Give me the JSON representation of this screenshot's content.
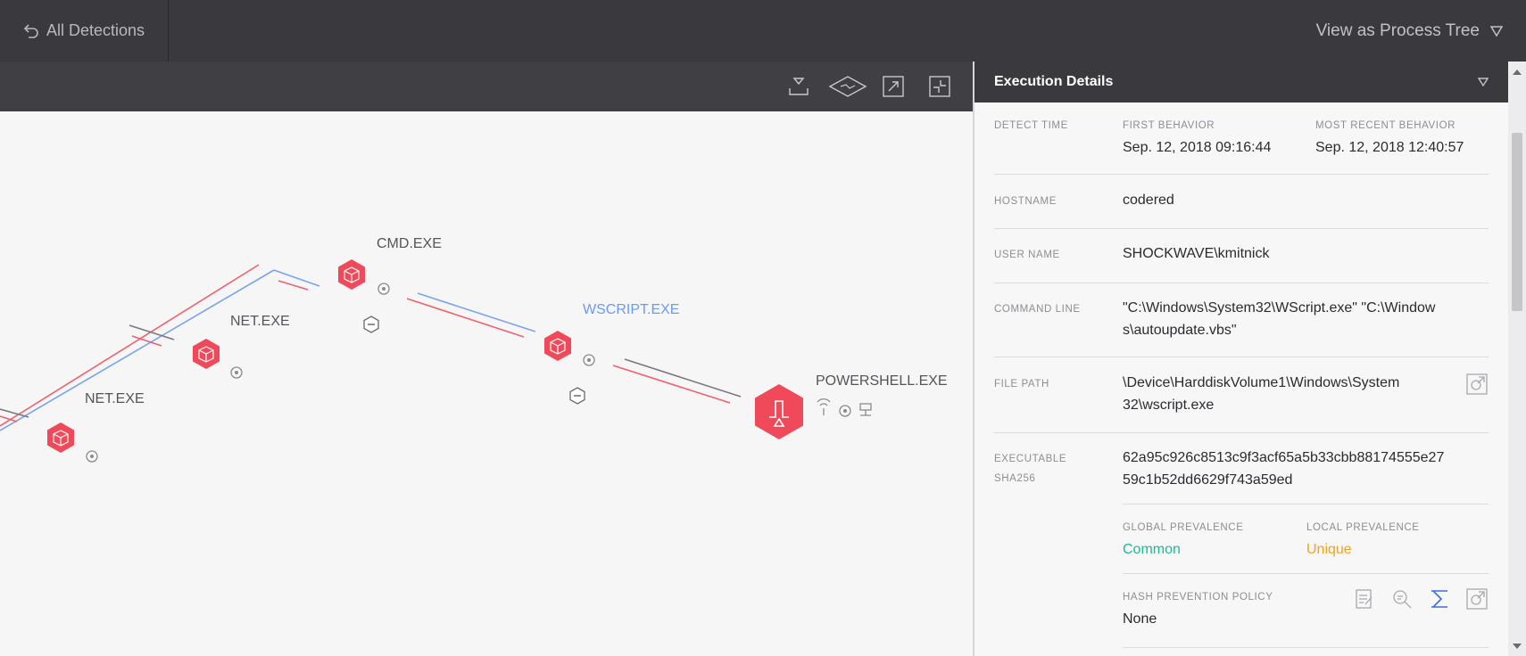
{
  "header": {
    "back_label": "All Detections",
    "view_label": "View as Process Tree"
  },
  "graph": {
    "nodes": [
      {
        "name": "CMD.EXE"
      },
      {
        "name": "NET.EXE"
      },
      {
        "name": "WSCRIPT.EXE"
      },
      {
        "name": "NET.EXE"
      },
      {
        "name": "POWERSHELL.EXE"
      }
    ]
  },
  "panel": {
    "title": "Execution Details",
    "detect_time_label": "DETECT TIME",
    "first_behavior_label": "FIRST BEHAVIOR",
    "first_behavior": "Sep. 12, 2018 09:16:44",
    "recent_behavior_label": "MOST RECENT BEHAVIOR",
    "recent_behavior": "Sep. 12, 2018 12:40:57",
    "hostname_label": "HOSTNAME",
    "hostname": "codered",
    "username_label": "USER NAME",
    "username": "SHOCKWAVE\\kmitnick",
    "cmdline_label": "COMMAND LINE",
    "cmdline_1": "\"C:\\Windows\\System32\\WScript.exe\" \"C:\\Window",
    "cmdline_2": "s\\autoupdate.vbs\"",
    "filepath_label": "FILE PATH",
    "filepath_1": "\\Device\\HarddiskVolume1\\Windows\\System",
    "filepath_2": "32\\wscript.exe",
    "sha_label_1": "EXECUTABLE",
    "sha_label_2": "SHA256",
    "sha_1": "62a95c926c8513c9f3acf65a5b33cbb88174555e27",
    "sha_2": "59c1b52dd6629f743a59ed",
    "global_prev_label": "GLOBAL PREVALENCE",
    "global_prev": "Common",
    "local_prev_label": "LOCAL PREVALENCE",
    "local_prev": "Unique",
    "hash_policy_label": "HASH PREVENTION POLICY",
    "hash_policy": "None"
  },
  "colors": {
    "critical": "#f04a5a",
    "selected": "#6b9af0",
    "common": "#1fb894",
    "unique": "#f0a21f",
    "line_red": "#f0606e",
    "line_blue": "#7aa3ef",
    "line_gray": "#7a797e"
  }
}
